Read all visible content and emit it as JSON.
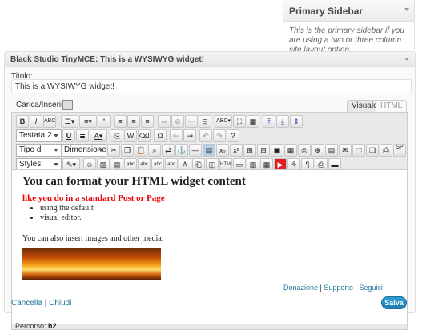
{
  "sidebar": {
    "title": "Primary Sidebar",
    "description": "This is the primary sidebar if you are using a two or three column site layout option."
  },
  "widget": {
    "title_prefix": "Black Studio TinyMCE:",
    "title_name": "This is a WYSIWYG widget!",
    "title_label": "Titolo:",
    "title_value": "This is a WYSIWYG widget!",
    "upload_label": "Carica/Inserisci",
    "tabs": [
      "Visuale",
      "HTML"
    ],
    "selects": {
      "format": "Testata 2",
      "font_family": "Tipo di caratte",
      "font_size": "Dimensione",
      "styles": "Styles"
    },
    "content": {
      "heading": "You can format your HTML widget content",
      "subheading": "like you do in a standard Post or Page",
      "list_items": [
        "using the default",
        "visual editor."
      ],
      "paragraph": "You can also insert images and other media:"
    },
    "status": {
      "label": "Percorso:",
      "path": "h2"
    },
    "links": [
      "Donazione",
      "Supporto",
      "Seguici"
    ],
    "link_separator": "|",
    "cancel_label": "Cancella",
    "close_label": "Chiudi",
    "save_label": "Salva"
  },
  "colors": {
    "link": "#21759b",
    "subheading": "#ee0000",
    "save_button": "#2e9fd2"
  }
}
